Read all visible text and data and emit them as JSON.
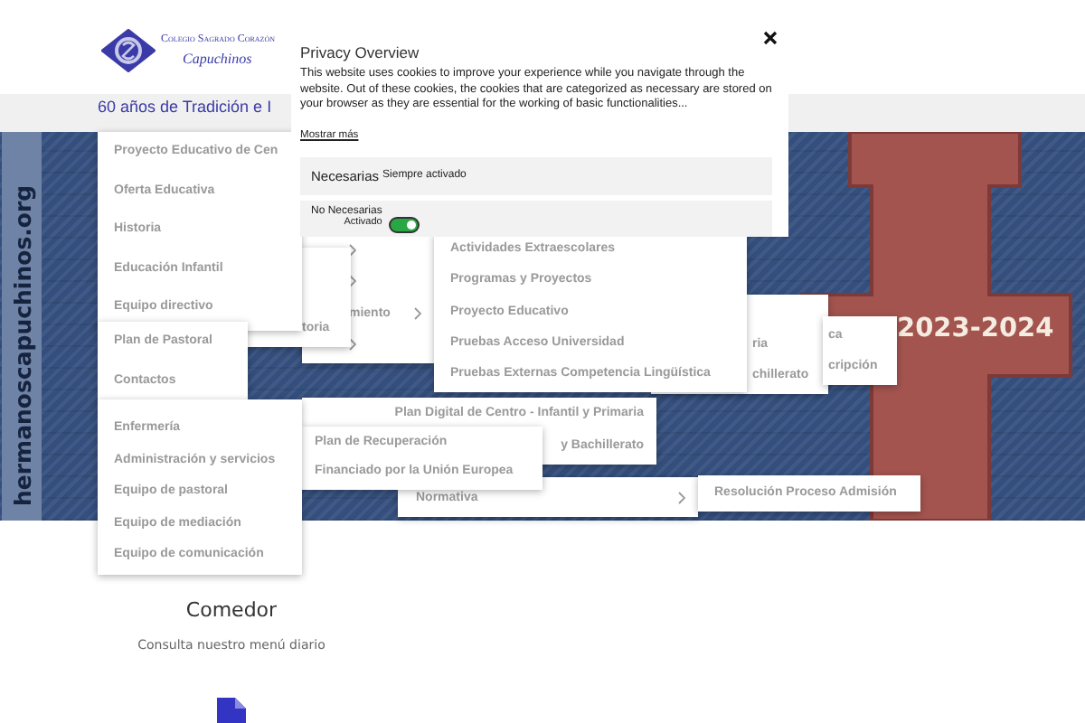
{
  "logo": {
    "line1": "Colegio Sagrado Corazón",
    "line2": "Capuchinos"
  },
  "tagline": "60 años de Tradición e I",
  "banner": {
    "side_text": "hermanoscapuchinos.org",
    "year": "2023-2024"
  },
  "menus": [
    {
      "items": [
        {
          "submenu": true
        },
        {
          "submenu": true
        },
        {
          "label": "miento",
          "submenu": true
        },
        {
          "submenu": true
        }
      ]
    },
    {
      "items": [
        {
          "label": "toria",
          "submenu": false
        }
      ]
    },
    {
      "items": [
        {
          "label": "ria",
          "submenu": false
        },
        {
          "label": "chillerato",
          "submenu": false
        }
      ]
    },
    {
      "items": [
        {
          "label": "ca",
          "submenu": false
        },
        {
          "label": "cripción",
          "submenu": false
        }
      ]
    },
    {
      "items": [
        {
          "label": "Actividades Extraescolares",
          "submenu": false
        },
        {
          "label": "Programas y Proyectos",
          "submenu": false
        },
        {
          "label": "Proyecto Educativo",
          "submenu": false
        },
        {
          "label": "Pruebas Acceso Universidad",
          "submenu": false
        },
        {
          "label": "Pruebas Externas Competencia Lingüística",
          "submenu": false
        }
      ]
    },
    {
      "items": [
        {
          "label": "Normativa",
          "submenu": true
        }
      ]
    },
    {
      "items": [
        {
          "label": "Resolución Proceso Admisión",
          "submenu": false
        }
      ]
    },
    {
      "items": [
        {
          "label": "Plan Digital de Centro - Infantil y Primaria",
          "submenu": false
        },
        {
          "label": "y Bachillerato",
          "submenu": false
        }
      ]
    },
    {
      "items": [
        {
          "label": "Plan de Recuperación",
          "submenu": false
        },
        {
          "label": "Financiado por la Unión Europea",
          "submenu": false
        }
      ]
    },
    {
      "items": [
        {
          "label": "Proyecto Educativo de Cen",
          "submenu": false
        },
        {
          "label": "Oferta Educativa",
          "submenu": false
        },
        {
          "label": "Historia",
          "submenu": false
        },
        {
          "label": "Educación Infantil",
          "submenu": false
        },
        {
          "label": "Equipo directivo",
          "submenu": false
        }
      ]
    },
    {
      "items": [
        {
          "label": "Plan de Pastoral",
          "submenu": false
        },
        {
          "label": "Contactos",
          "submenu": false
        }
      ]
    },
    {
      "items": [
        {
          "label": "Enfermería",
          "submenu": false
        },
        {
          "label": "Administración y servicios",
          "submenu": false
        },
        {
          "label": "Equipo de pastoral",
          "submenu": false
        },
        {
          "label": "Equipo de mediación",
          "submenu": false
        },
        {
          "label": "Equipo de comunicación",
          "submenu": false
        }
      ]
    }
  ],
  "privacy": {
    "title": "Privacy Overview",
    "text": "This website uses cookies to improve your experience while you navigate through the website. Out of these cookies, the cookies that are categorized as necessary are stored on your browser as they are essential for the working of basic functionalities...",
    "more_link": "Mostrar más",
    "necessary": {
      "label": "Necesarias",
      "status": "Siempre activado"
    },
    "optional": {
      "label": "No Necesarias",
      "status": "Activado",
      "on": true
    }
  },
  "section": {
    "title": "Comedor",
    "subtitle": "Consulta nuestro menú diario"
  }
}
